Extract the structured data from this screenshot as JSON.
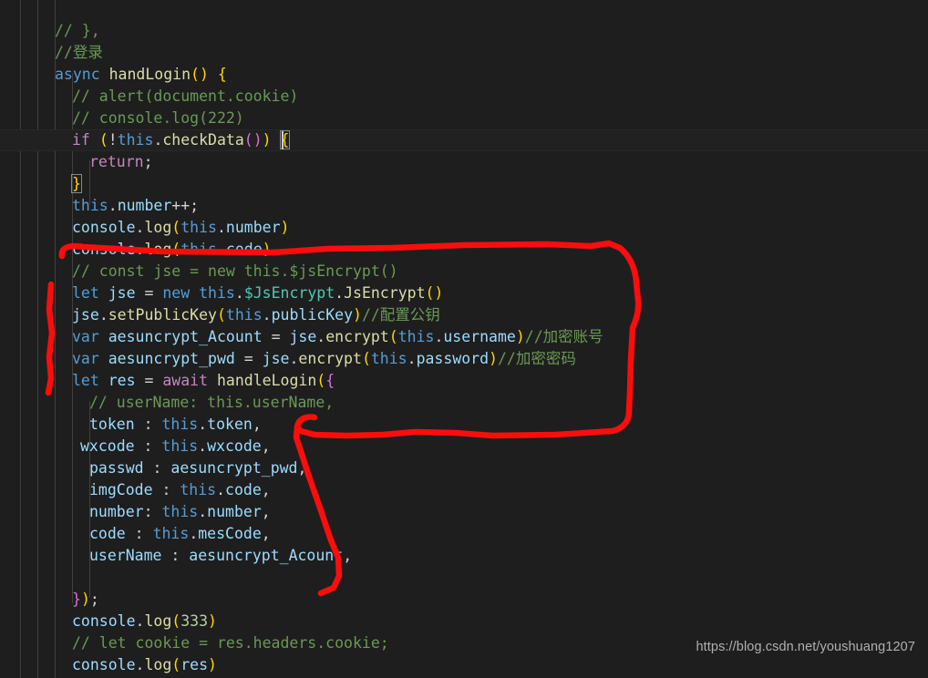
{
  "editor": {
    "theme": "dark-plus",
    "background_color": "#1e1e1e",
    "current_line_color": "#212121",
    "indent_guide_color": "#404040",
    "annotation_color": "#fb0d0d",
    "current_line_number": 6,
    "font_size_px": 16.5,
    "line_height_px": 24
  },
  "watermark": {
    "text": "https://blog.csdn.net/youshuang1207"
  },
  "code_lines": [
    {
      "n": 1,
      "indent": 4,
      "text": "// },"
    },
    {
      "n": 2,
      "indent": 4,
      "text": "//登录"
    },
    {
      "n": 3,
      "indent": 4,
      "text": "async handLogin() {"
    },
    {
      "n": 4,
      "indent": 5,
      "text": "// alert(document.cookie)"
    },
    {
      "n": 5,
      "indent": 5,
      "text": "// console.log(222)"
    },
    {
      "n": 6,
      "indent": 5,
      "text": "if (!this.checkData()) {"
    },
    {
      "n": 7,
      "indent": 6,
      "text": "return;"
    },
    {
      "n": 8,
      "indent": 5,
      "text": "}"
    },
    {
      "n": 9,
      "indent": 5,
      "text": "this.number++;"
    },
    {
      "n": 10,
      "indent": 5,
      "text": "console.log(this.number)"
    },
    {
      "n": 11,
      "indent": 5,
      "text": "console.log(this.code)"
    },
    {
      "n": 12,
      "indent": 5,
      "text": "// const jse = new this.$jsEncrypt()"
    },
    {
      "n": 13,
      "indent": 5,
      "text": "let jse = new this.$JsEncrypt.JsEncrypt()"
    },
    {
      "n": 14,
      "indent": 5,
      "text": "jse.setPublicKey(this.publicKey)//配置公钥"
    },
    {
      "n": 15,
      "indent": 5,
      "text": "var aesuncrypt_Acount = jse.encrypt(this.username)//加密账号"
    },
    {
      "n": 16,
      "indent": 5,
      "text": "var aesuncrypt_pwd = jse.encrypt(this.password)//加密密码"
    },
    {
      "n": 17,
      "indent": 5,
      "text": "let res = await handleLogin({"
    },
    {
      "n": 18,
      "indent": 6,
      "text": "// userName: this.userName,"
    },
    {
      "n": 19,
      "indent": 6,
      "text": "token : this.token,"
    },
    {
      "n": 20,
      "indent": 6,
      "text": "wxcode : this.wxcode,"
    },
    {
      "n": 21,
      "indent": 6,
      "text": "passwd : aesuncrypt_pwd,"
    },
    {
      "n": 22,
      "indent": 6,
      "text": "imgCode : this.code,"
    },
    {
      "n": 23,
      "indent": 6,
      "text": "number: this.number,"
    },
    {
      "n": 24,
      "indent": 6,
      "text": "code : this.mesCode,"
    },
    {
      "n": 25,
      "indent": 6,
      "text": "userName : aesuncrypt_Acount,"
    },
    {
      "n": 26,
      "indent": 0,
      "text": ""
    },
    {
      "n": 27,
      "indent": 5,
      "text": "});"
    },
    {
      "n": 28,
      "indent": 5,
      "text": "console.log(333)"
    },
    {
      "n": 29,
      "indent": 5,
      "text": "// let cookie = res.headers.cookie;"
    },
    {
      "n": 30,
      "indent": 5,
      "text": "console.log(res)"
    }
  ],
  "annotations": [
    {
      "name": "encryption-block-circle",
      "shape": "freehand-loop",
      "color": "#fb0d0d"
    },
    {
      "name": "payload-object-stroke",
      "shape": "freehand-hook",
      "color": "#fb0d0d"
    }
  ]
}
